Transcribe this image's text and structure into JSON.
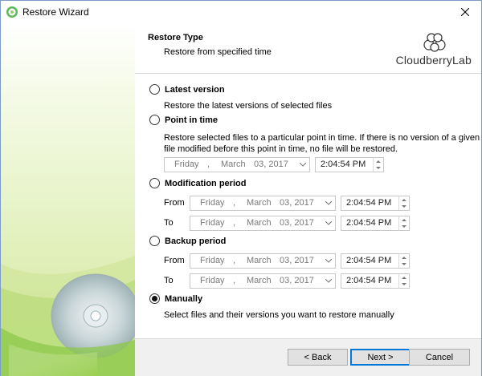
{
  "window": {
    "title": "Restore Wizard"
  },
  "header": {
    "title": "Restore Type",
    "subtitle": "Restore from specified time",
    "logo_text": "CloudberryLab"
  },
  "options": {
    "latest": {
      "label": "Latest version",
      "description": "Restore the latest versions of selected files",
      "checked": false
    },
    "point": {
      "label": "Point in time",
      "description_line1": "Restore selected files to a particular point in time. If there is no version of a given",
      "description_line2": "file modified before this point in time, no file will be restored.",
      "checked": false,
      "date": {
        "weekday": "Friday",
        "month": "March",
        "daynum": "03, 2017"
      },
      "time": "2:04:54 PM"
    },
    "modification": {
      "label": "Modification period",
      "checked": false,
      "from_label": "From",
      "to_label": "To",
      "from": {
        "weekday": "Friday",
        "month": "March",
        "daynum": "03, 2017",
        "time": "2:04:54 PM"
      },
      "to": {
        "weekday": "Friday",
        "month": "March",
        "daynum": "03, 2017",
        "time": "2:04:54 PM"
      }
    },
    "backup": {
      "label": "Backup period",
      "checked": false,
      "from_label": "From",
      "to_label": "To",
      "from": {
        "weekday": "Friday",
        "month": "March",
        "daynum": "03, 2017",
        "time": "2:04:54 PM"
      },
      "to": {
        "weekday": "Friday",
        "month": "March",
        "daynum": "03, 2017",
        "time": "2:04:54 PM"
      }
    },
    "manual": {
      "label": "Manually",
      "description": "Select files and their versions you want to restore manually",
      "checked": true
    }
  },
  "date_separator": ",",
  "buttons": {
    "back": "< Back",
    "next": "Next >",
    "cancel": "Cancel"
  },
  "colors": {
    "accent": "#0078d7",
    "sidebar_green": "#d3e6a0"
  },
  "icons": {
    "app": "cloudberry-app-icon",
    "close": "close-icon",
    "dropdown": "chevron-down-icon",
    "spinner": "spinner-icon"
  }
}
